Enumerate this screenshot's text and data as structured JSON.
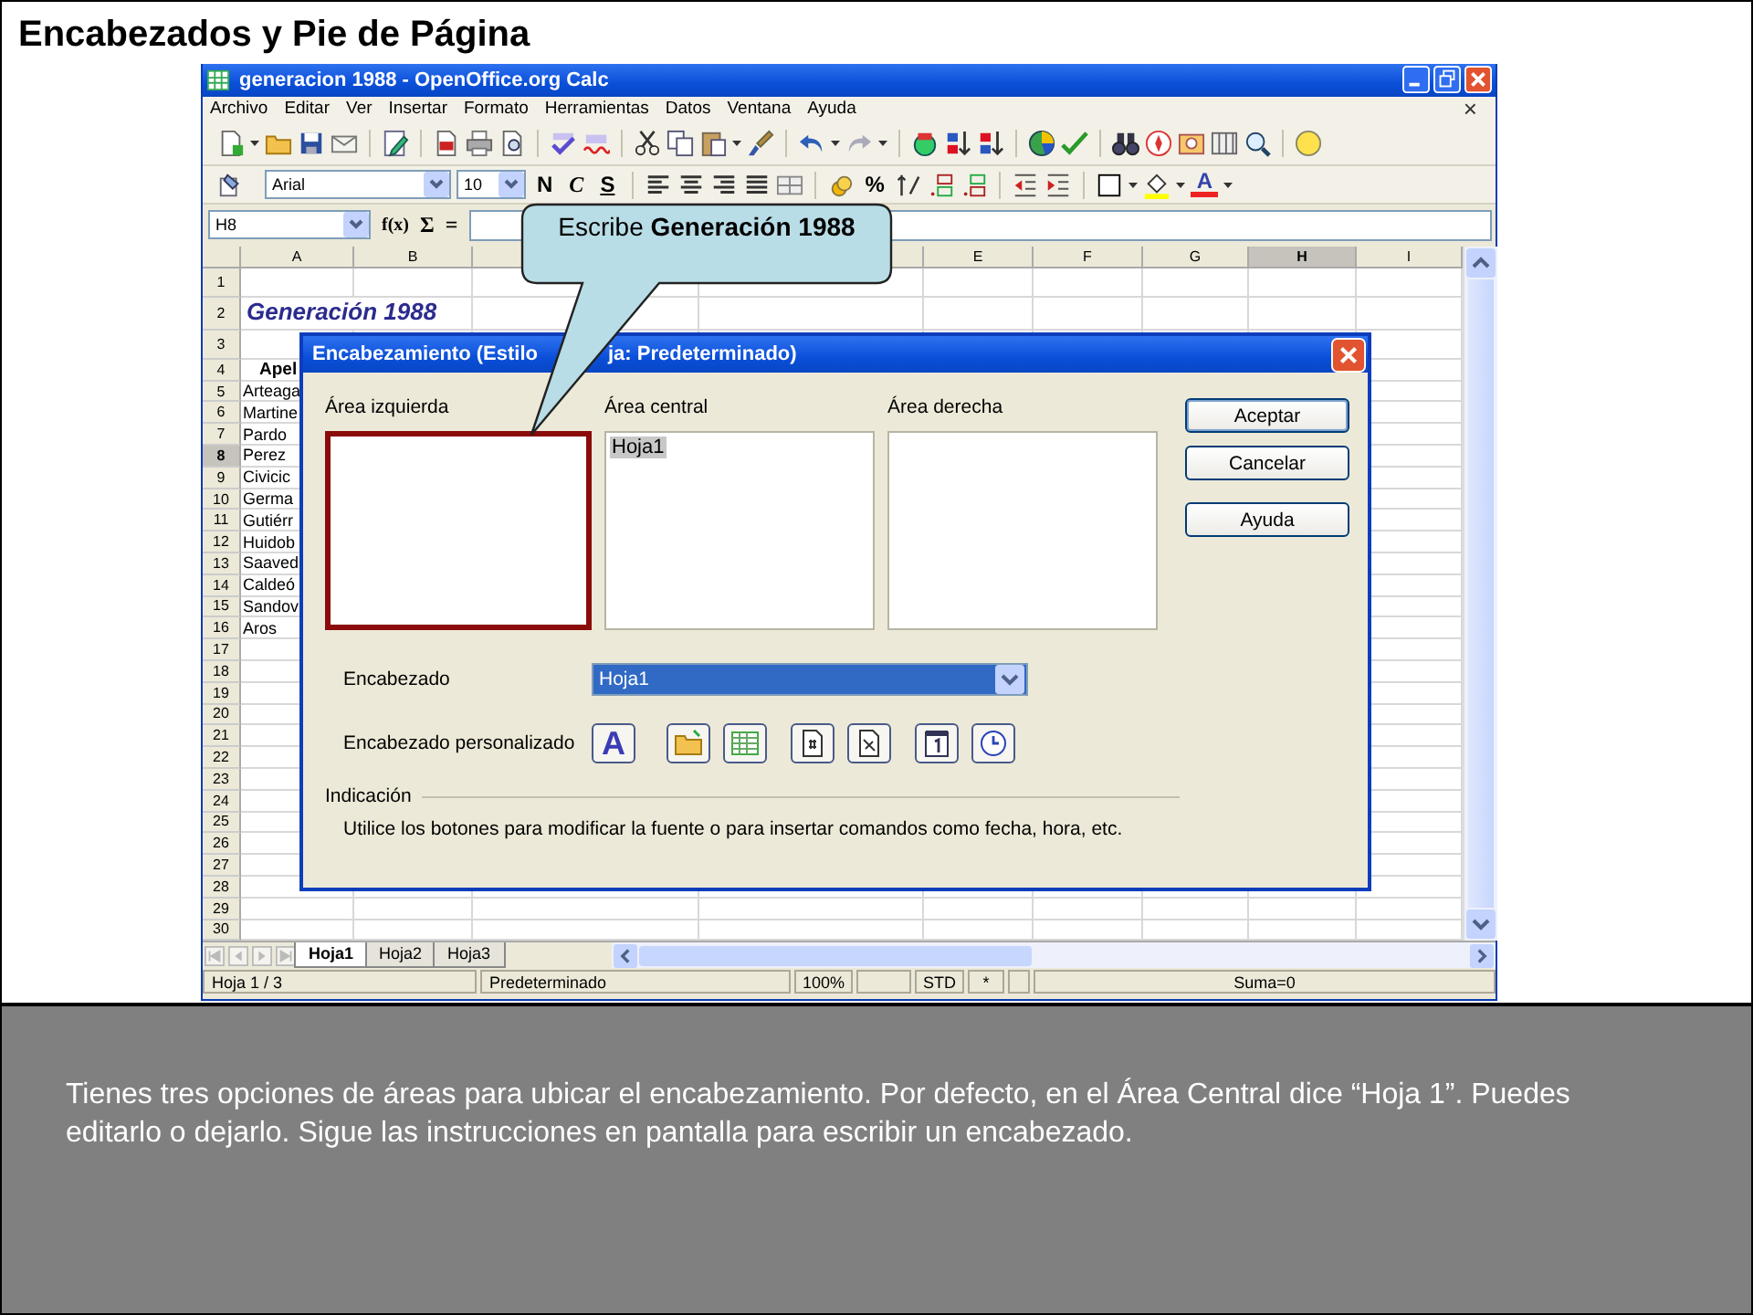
{
  "slide": {
    "title": "Encabezados y Pie de Página",
    "caption": "Tienes tres opciones de áreas para ubicar el encabezamiento. Por defecto, en el Área Central dice “Hoja 1”. Puedes editarlo o dejarlo. Sigue las instrucciones en pantalla para escribir un encabezado."
  },
  "window": {
    "title": "generacion 1988 - OpenOffice.org Calc"
  },
  "menu": {
    "items": [
      "Archivo",
      "Editar",
      "Ver",
      "Insertar",
      "Formato",
      "Herramientas",
      "Datos",
      "Ventana",
      "Ayuda"
    ],
    "close": "×"
  },
  "format_toolbar": {
    "font": "Arial",
    "size": "10",
    "bold": "N",
    "italic": "C",
    "underline": "S",
    "percent": "%",
    "font_color": "A"
  },
  "formula_bar": {
    "cell": "H8",
    "function": "f(x)",
    "sum": "Σ",
    "equals": "="
  },
  "sheet": {
    "columns": [
      {
        "label": "A",
        "selected": false
      },
      {
        "label": "B",
        "selected": false
      },
      {
        "label": "E",
        "selected": false
      },
      {
        "label": "F",
        "selected": false
      },
      {
        "label": "G",
        "selected": false
      },
      {
        "label": "H",
        "selected": true
      },
      {
        "label": "I",
        "selected": false
      }
    ],
    "rows": [
      {
        "number": "1",
        "selected": false
      },
      {
        "number": "2",
        "selected": false,
        "kind": "title",
        "cell": "Generación 1988"
      },
      {
        "number": "3",
        "selected": false
      },
      {
        "number": "4",
        "selected": false,
        "kind": "header",
        "cell": "Apel"
      },
      {
        "number": "5",
        "selected": false,
        "kind": "name",
        "cell": "Arteaga"
      },
      {
        "number": "6",
        "selected": false,
        "kind": "name",
        "cell": "Martine"
      },
      {
        "number": "7",
        "selected": false,
        "kind": "name",
        "cell": "Pardo"
      },
      {
        "number": "8",
        "selected": true,
        "kind": "name",
        "cell": "Perez"
      },
      {
        "number": "9",
        "selected": false,
        "kind": "name",
        "cell": "Civicic"
      },
      {
        "number": "10",
        "selected": false,
        "kind": "name",
        "cell": "Germa"
      },
      {
        "number": "11",
        "selected": false,
        "kind": "name",
        "cell": "Gutiérr"
      },
      {
        "number": "12",
        "selected": false,
        "kind": "name",
        "cell": "Huidob"
      },
      {
        "number": "13",
        "selected": false,
        "kind": "name",
        "cell": "Saaved"
      },
      {
        "number": "14",
        "selected": false,
        "kind": "name",
        "cell": "Caldeó"
      },
      {
        "number": "15",
        "selected": false,
        "kind": "name",
        "cell": "Sandov"
      },
      {
        "number": "16",
        "selected": false,
        "kind": "name",
        "cell": "Aros"
      },
      {
        "number": "17",
        "selected": false
      },
      {
        "number": "18",
        "selected": false
      },
      {
        "number": "19",
        "selected": false
      },
      {
        "number": "20",
        "selected": false
      },
      {
        "number": "21",
        "selected": false
      },
      {
        "number": "22",
        "selected": false
      },
      {
        "number": "23",
        "selected": false
      },
      {
        "number": "24",
        "selected": false
      },
      {
        "number": "25",
        "selected": false
      },
      {
        "number": "26",
        "selected": false
      },
      {
        "number": "27",
        "selected": false
      },
      {
        "number": "28",
        "selected": false
      },
      {
        "number": "29",
        "selected": false
      },
      {
        "number": "30",
        "selected": false
      }
    ]
  },
  "sheet_tabs": [
    {
      "label": "Hoja1",
      "selected": true
    },
    {
      "label": "Hoja2",
      "selected": false
    },
    {
      "label": "Hoja3",
      "selected": false
    }
  ],
  "status_bar": {
    "page": "Hoja 1 / 3",
    "style": "Predeterminado",
    "zoom": "100%",
    "mode": "STD",
    "modified": "*",
    "sum": "Suma=0"
  },
  "callout": {
    "text": "Escribe **Generación 1988**"
  },
  "dialog": {
    "title_parts": [
      "Encabezamiento (Estilo",
      "ja: Predeterminado)"
    ],
    "areas": [
      {
        "label": "Área izquierda",
        "highlighted": true
      },
      {
        "label": "Área central",
        "highlighted": false,
        "content": "Hoja1",
        "content_selected": true
      },
      {
        "label": "Área derecha",
        "highlighted": false
      }
    ],
    "buttons": [
      {
        "label": "Aceptar",
        "default": true
      },
      {
        "label": "Cancelar",
        "default": false
      },
      {
        "label": "Ayuda",
        "default": false
      }
    ],
    "header_label": "Encabezado",
    "header_value": "Hoja1",
    "custom_label": "Encabezado personalizado",
    "font_button": "A",
    "hint_title": "Indicación",
    "hint": "Utilice los botones para modificar la fuente o para insertar comandos como fecha, hora, etc."
  }
}
